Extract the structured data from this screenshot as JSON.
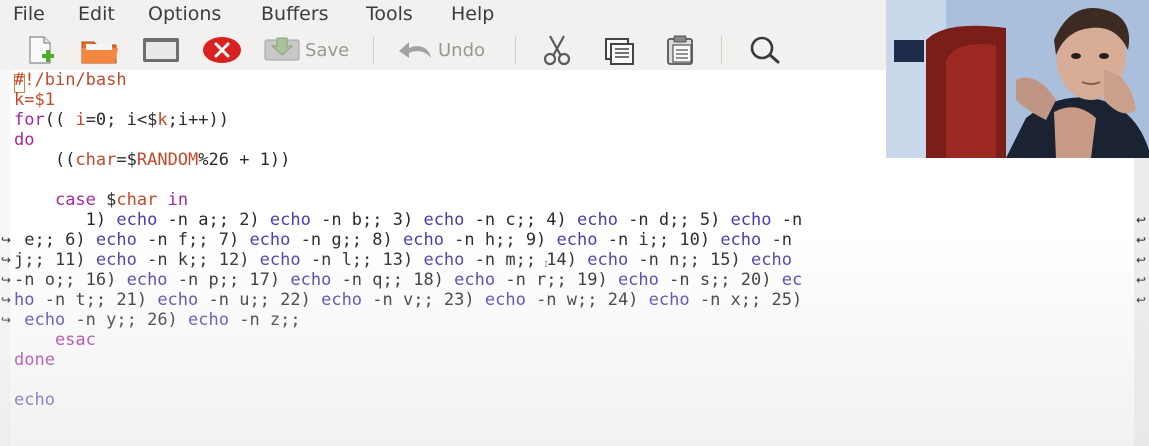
{
  "menu": [
    "File",
    "Edit",
    "Options",
    "Buffers",
    "Tools",
    "Help"
  ],
  "toolbar": {
    "new_icon": "new-file-icon",
    "open_icon": "open-folder-icon",
    "dired_icon": "dired-window-icon",
    "close_icon": "close-icon",
    "save_label": "Save",
    "undo_label": "Undo",
    "cut_icon": "cut-icon",
    "copy_icon": "copy-icon",
    "paste_icon": "paste-icon",
    "search_icon": "search-icon"
  },
  "editor": {
    "l1a": "#",
    "l1b": "!/bin/bash",
    "l2a": "k",
    "l2b": "=$1",
    "l3a": "for",
    "l3b": "(( ",
    "l3c": "i",
    "l3d": "=0; i<$",
    "l3e": "k",
    "l3f": ";i++))",
    "l4a": "do",
    "l5a": "    ((",
    "l5b": "char",
    "l5c": "=$",
    "l5d": "RANDOM",
    "l5e": "%26 + 1))",
    "l7a": "    ",
    "l7b": "case",
    "l7c": " $",
    "l7d": "char",
    "l7e": " in",
    "w1": [
      "       1) ",
      "echo",
      " -n a;; 2) ",
      "echo",
      " -n b;; 3) ",
      "echo",
      " -n c;; 4) ",
      "echo",
      " -n d;; 5) ",
      "echo",
      " -n"
    ],
    "w2": [
      " e;; 6) ",
      "echo",
      " -n f;; 7) ",
      "echo",
      " -n g;; 8) ",
      "echo",
      " -n h;; 9) ",
      "echo",
      " -n i;; 10) ",
      "echo",
      " -n "
    ],
    "w3": [
      "j;; 11) ",
      "echo",
      " -n k;; 12) ",
      "echo",
      " -n l;; 13) ",
      "echo",
      " -n m;; 14) ",
      "echo",
      " -n n;; 15) ",
      "echo",
      " "
    ],
    "w4": [
      "-n o;; 16) ",
      "echo",
      " -n p;; 17) ",
      "echo",
      " -n q;; 18) ",
      "echo",
      " -n r;; 19) ",
      "echo",
      " -n s;; 20) ",
      "ec",
      ""
    ],
    "w5": [
      "ho",
      " -n t;; 21) ",
      "echo",
      " -n u;; 22) ",
      "echo",
      " -n v;; 23) ",
      "echo",
      " -n w;; 24) ",
      "echo",
      " -n x;; 25)",
      ""
    ],
    "w6": [
      " ",
      "echo",
      " -n y;; 26) ",
      "echo",
      " -n z;;"
    ],
    "l14a": "    esac",
    "l15a": "done",
    "l17a": "echo",
    "wrap_glyph_right": "↩",
    "wrap_glyph_left": "↪"
  },
  "colors": {
    "keyword": "#a626a4",
    "variable": "#c5482a",
    "builtin": "#4a3bb0"
  }
}
